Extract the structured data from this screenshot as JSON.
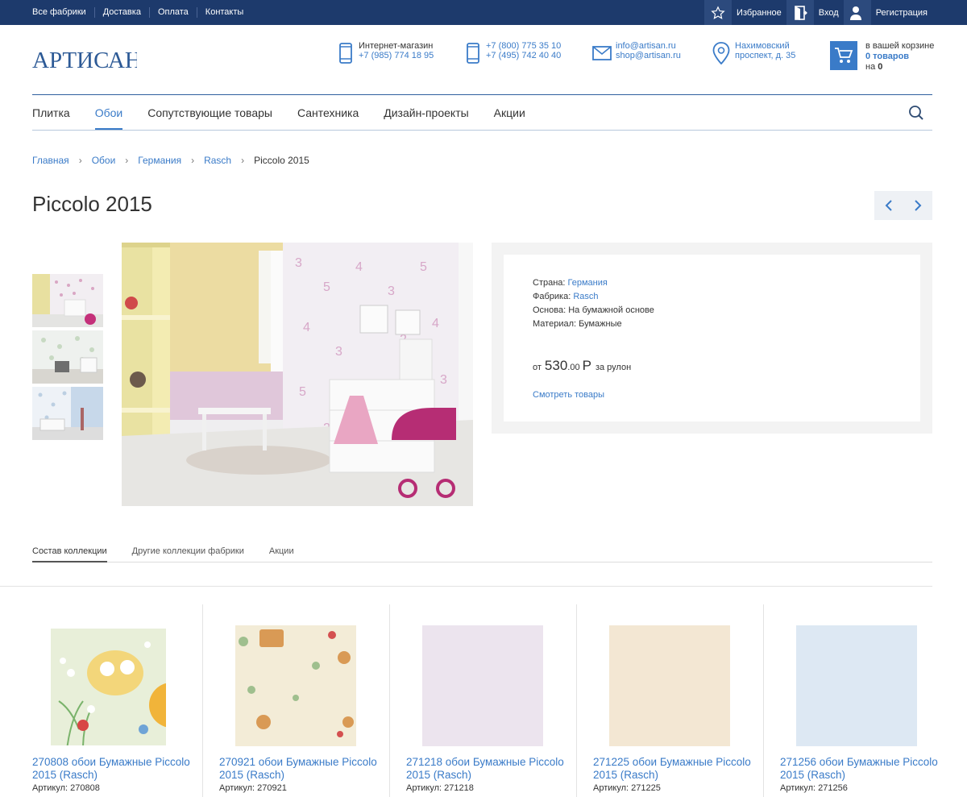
{
  "topbar": {
    "links": [
      "Все фабрики",
      "Доставка",
      "Оплата",
      "Контакты"
    ],
    "favorites": "Избранное",
    "login": "Вход",
    "register": "Регистрация"
  },
  "header": {
    "logo_text": "АРТИСАН",
    "shop_label": "Интернет-магазин",
    "shop_phone": "+7 (985) 774 18 95",
    "phone1": "+7 (800) 775 35 10",
    "phone2": "+7 (495) 742 40 40",
    "email1": "info@artisan.ru",
    "email2": "shop@artisan.ru",
    "address1": "Нахимовский",
    "address2": "проспект, д. 35",
    "cart_line1": "в вашей корзине",
    "cart_line2": "0 товаров",
    "cart_line3_prefix": "на",
    "cart_line3_value": "0"
  },
  "nav": {
    "items": [
      "Плитка",
      "Обои",
      "Сопутствующие товары",
      "Сантехника",
      "Дизайн-проекты",
      "Акции"
    ],
    "active_index": 1
  },
  "breadcrumb": [
    "Главная",
    "Обои",
    "Германия",
    "Rasch",
    "Piccolo 2015"
  ],
  "page_title": "Piccolo 2015",
  "info": {
    "country_label": "Страна:",
    "country_value": "Германия",
    "factory_label": "Фабрика:",
    "factory_value": "Rasch",
    "base_label": "Основа:",
    "base_value": "На бумажной основе",
    "material_label": "Материал:",
    "material_value": "Бумажные",
    "price_from": "от",
    "price_int": "530",
    "price_cents": ".00",
    "price_currency": "Р",
    "price_unit": "за рулон",
    "see_goods": "Смотреть товары"
  },
  "tabs": [
    "Состав коллекции",
    "Другие коллекции фабрики",
    "Акции"
  ],
  "products": [
    {
      "name": "270808 обои Бумажные Piccolo 2015 (Rasch)",
      "article": "Артикул: 270808"
    },
    {
      "name": "270921 обои Бумажные Piccolo 2015 (Rasch)",
      "article": "Артикул: 270921"
    },
    {
      "name": "271218 обои Бумажные Piccolo 2015 (Rasch)",
      "article": "Артикул: 271218"
    },
    {
      "name": "271225 обои Бумажные Piccolo 2015 (Rasch)",
      "article": "Артикул: 271225"
    },
    {
      "name": "271256 обои Бумажные Piccolo 2015 (Rasch)",
      "article": "Артикул: 271256"
    }
  ],
  "colors": {
    "topbar": "#1d3a6c",
    "accent": "#3a7bc8"
  }
}
